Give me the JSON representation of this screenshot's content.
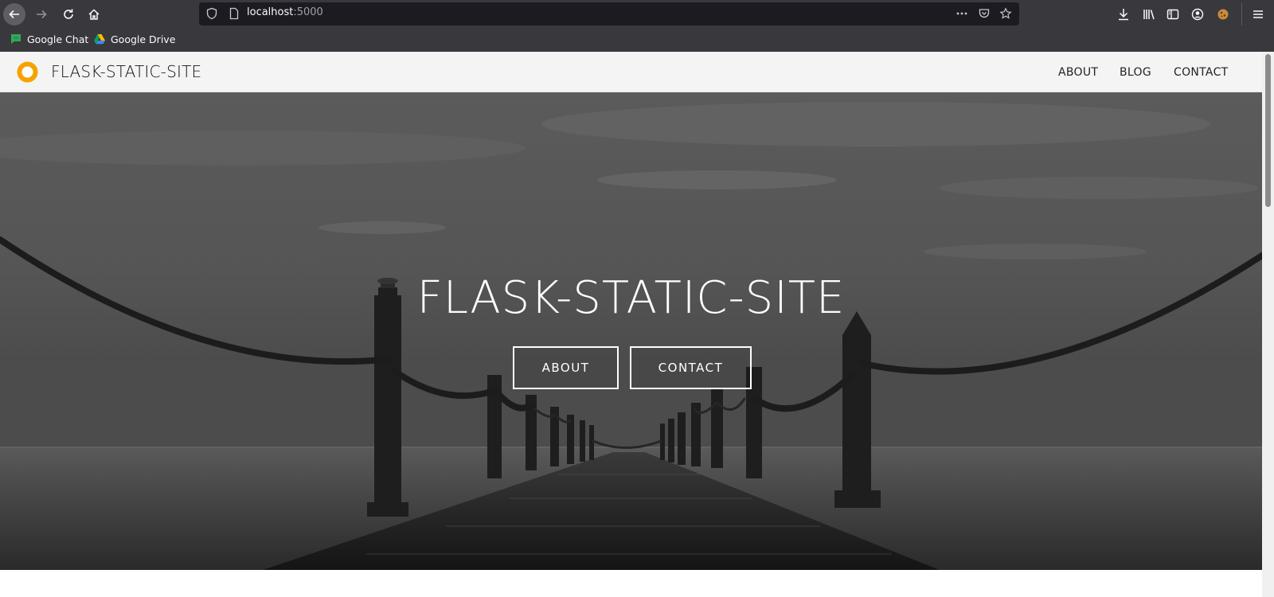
{
  "browser": {
    "url_host": "localhost",
    "url_port": ":5000",
    "bookmarks": [
      {
        "label": "Google Chat",
        "icon": "google-chat-icon"
      },
      {
        "label": "Google Drive",
        "icon": "google-drive-icon"
      }
    ]
  },
  "site": {
    "brand": "FLASK-STATIC-SITE",
    "nav": [
      {
        "label": "ABOUT"
      },
      {
        "label": "BLOG"
      },
      {
        "label": "CONTACT"
      }
    ],
    "hero": {
      "title": "FLASK-STATIC-SITE",
      "buttons": [
        {
          "label": "ABOUT"
        },
        {
          "label": "CONTACT"
        }
      ]
    }
  },
  "colors": {
    "chrome": "#38383d",
    "urlbar": "#1c1b22",
    "logo_accent": "#f5a302",
    "nav_bg": "#f4f4f4"
  }
}
